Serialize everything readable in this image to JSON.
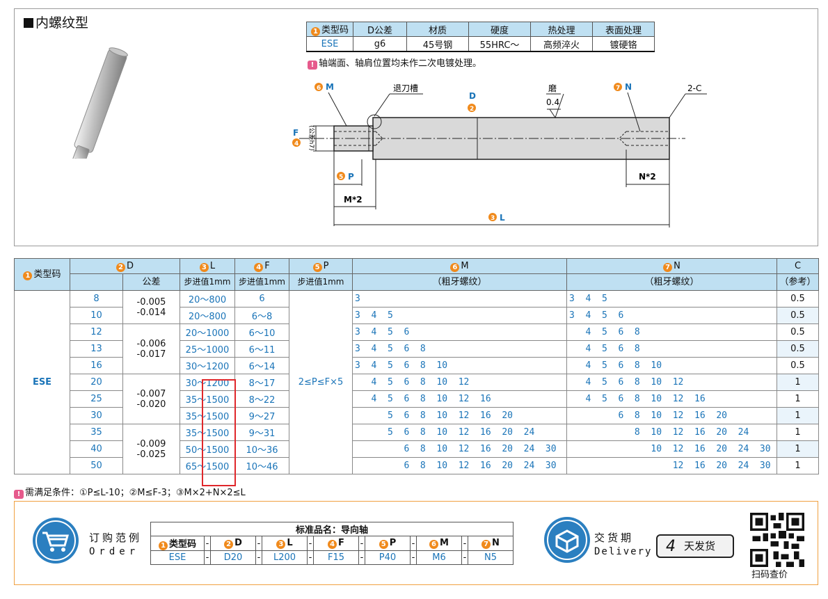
{
  "title": "内螺纹型",
  "spec": {
    "headers": [
      "类型码",
      "D公差",
      "材质",
      "硬度",
      "热处理",
      "表面处理"
    ],
    "header_num": "1",
    "row": [
      "ESE",
      "g6",
      "45号钢",
      "55HRC～",
      "高频淬火",
      "镀硬铬"
    ]
  },
  "note1": "轴端面、轴肩位置均未作二次电镀处理。",
  "drawing": {
    "n6": "6",
    "M": "M",
    "groove": "退刀槽",
    "n2": "2",
    "D": "D",
    "grind": "磨",
    "rough": "0.4",
    "n7": "7",
    "N": "N",
    "c2": "2-C",
    "n4": "4",
    "F": "F",
    "tol": "(公差h7)",
    "n5": "5",
    "P": "P",
    "M2": "M*2",
    "N2": "N*2",
    "n3": "3",
    "L": "L"
  },
  "table": {
    "h_type": "类型码",
    "h_type_num": "1",
    "h_D": "D",
    "h_D_num": "2",
    "h_tol": "公差",
    "h_L": "L",
    "h_L_num": "3",
    "h_L_sub": "步进值1mm",
    "h_F": "F",
    "h_F_num": "4",
    "h_F_sub": "步进值1mm",
    "h_P": "P",
    "h_P_num": "5",
    "h_P_sub": "步进值1mm",
    "h_M": "M",
    "h_M_num": "6",
    "h_M_sub": "（粗牙螺纹）",
    "h_N": "N",
    "h_N_num": "7",
    "h_N_sub": "（粗牙螺纹）",
    "h_C": "C",
    "h_C_sub": "（参考）",
    "type": "ESE",
    "p_range": "2≤P≤F×5",
    "tolerances": [
      {
        "up": "-0.005",
        "lo": "-0.014"
      },
      {
        "up": "-0.006",
        "lo": "-0.017"
      },
      {
        "up": "-0.007",
        "lo": "-0.020"
      },
      {
        "up": "-0.009",
        "lo": "-0.025"
      }
    ],
    "rows": [
      {
        "D": "8",
        "L": "20～800",
        "F": "6",
        "M": "3",
        "N": "3  4  5",
        "C": "0.5"
      },
      {
        "D": "10",
        "L": "20～800",
        "F": "6～8",
        "M": "3  4  5",
        "N": "3  4  5  6",
        "C": "0.5"
      },
      {
        "D": "12",
        "L": "20～1000",
        "F": "6～10",
        "M": "3  4  5  6",
        "N": "   4  5  6  8",
        "C": "0.5"
      },
      {
        "D": "13",
        "L": "25～1000",
        "F": "6～11",
        "M": "3  4  5  6  8",
        "N": "   4  5  6  8",
        "C": "0.5"
      },
      {
        "D": "16",
        "L": "30～1200",
        "F": "6～14",
        "M": "3  4  5  6  8  10",
        "N": "   4  5  6  8  10",
        "C": "0.5"
      },
      {
        "D": "20",
        "L": "30～1200",
        "F": "8～17",
        "M": "   4  5  6  8  10  12",
        "N": "   4  5  6  8  10  12",
        "C": "1"
      },
      {
        "D": "25",
        "L": "35～1500",
        "F": "8～22",
        "M": "   4  5  6  8  10  12  16",
        "N": "   4  5  6  8  10  12  16",
        "C": "1"
      },
      {
        "D": "30",
        "L": "35～1500",
        "F": "9～27",
        "M": "      5  6  8  10  12  16  20",
        "N": "         6  8  10  12  16  20",
        "C": "1"
      },
      {
        "D": "35",
        "L": "35～1500",
        "F": "9～31",
        "M": "      5  6  8  10  12  16  20  24",
        "N": "            8  10  12  16  20  24",
        "C": "1"
      },
      {
        "D": "40",
        "L": "50～1500",
        "F": "10～36",
        "M": "         6  8  10  12  16  20  24  30",
        "N": "               10  12  16  20  24  30",
        "C": "1"
      },
      {
        "D": "50",
        "L": "65～1500",
        "F": "10～46",
        "M": "         6  8  10  12  16  20  24  30",
        "N": "                   12  16  20  24  30",
        "C": "1"
      }
    ]
  },
  "note2": "需满足条件：①P≤L-10；②M≤F-3；③M×2+N×2≤L",
  "order": {
    "label_cn": "订购范例",
    "label_en": "Order",
    "caption": "标准品名：导向轴",
    "headers": [
      {
        "num": "1",
        "text": "类型码"
      },
      {
        "num": "2",
        "text": "D"
      },
      {
        "num": "3",
        "text": "L"
      },
      {
        "num": "4",
        "text": "F"
      },
      {
        "num": "5",
        "text": "P"
      },
      {
        "num": "6",
        "text": "M"
      },
      {
        "num": "7",
        "text": "N"
      }
    ],
    "values": [
      "ESE",
      "D20",
      "L200",
      "F15",
      "P40",
      "M6",
      "N5"
    ],
    "dash": "-"
  },
  "delivery": {
    "label_cn": "交货期",
    "label_en": "Delivery",
    "days": "4",
    "days_text": "天发货"
  },
  "qr_label": "扫码查价",
  "colors": {
    "header_bg": "#bfe0f2",
    "accent_orange": "#f08a1c",
    "accent_blue": "#1a74b8",
    "highlight": "#e0272b",
    "icon_blue": "#2b7fc0"
  }
}
